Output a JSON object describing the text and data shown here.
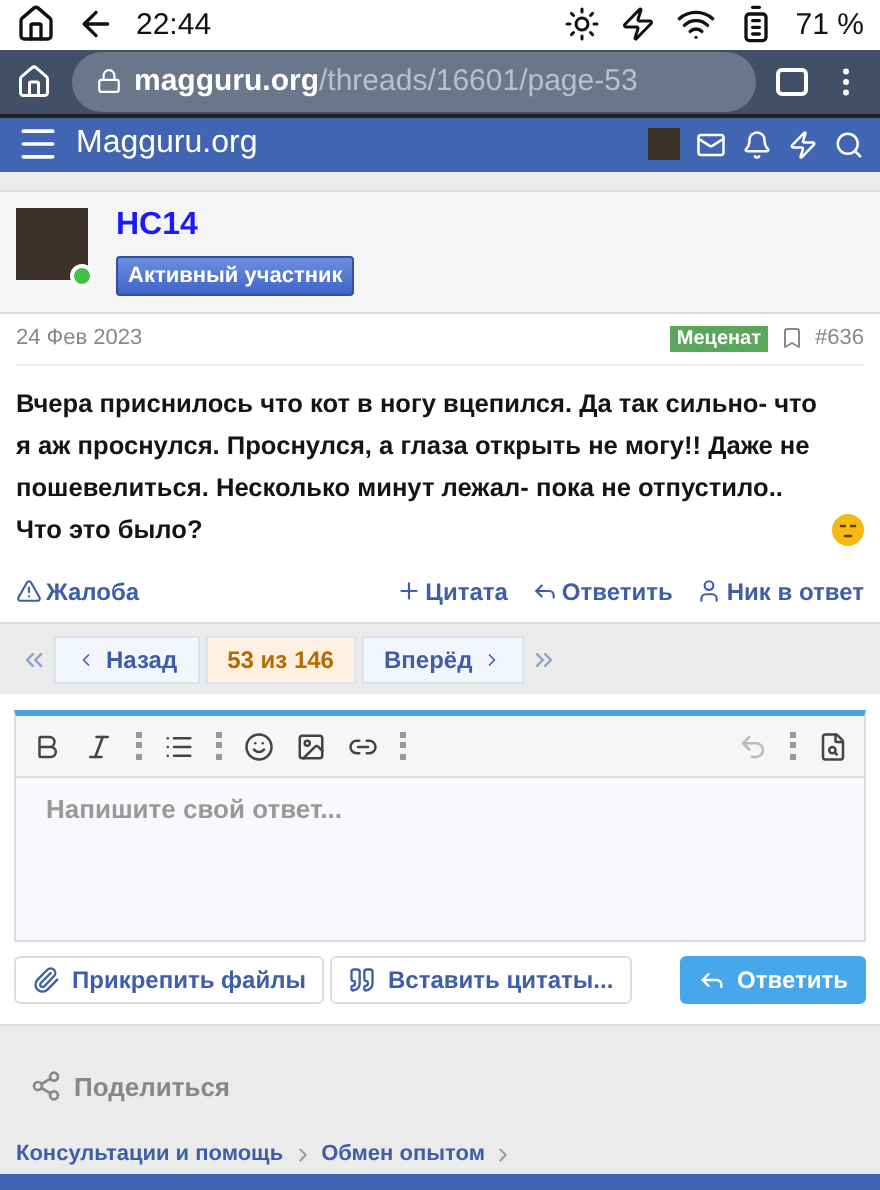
{
  "status_bar": {
    "time": "22:44",
    "battery": "71 %"
  },
  "browser": {
    "url_domain": "magguru.org",
    "url_path": "/threads/16601/page-53"
  },
  "site_nav": {
    "title": "Magguru.org"
  },
  "post": {
    "author": "HC14",
    "role": "Активный участник",
    "online": true,
    "date": "24 Фев 2023",
    "badge": "Меценат",
    "number": "#636",
    "text": "Вчера приснилось что кот в ногу вцепился. Да так сильно- что я аж проснулся. Проснулся, а глаза открыть не могу!! Даже не пошевелиться. Несколько минут лежал- пока не отпустило.. Что это было?",
    "actions": [
      {
        "kind": "report",
        "label": "Жалоба"
      },
      {
        "kind": "quote",
        "label": "Цитата"
      },
      {
        "kind": "reply",
        "label": "Ответить"
      },
      {
        "kind": "mention",
        "label": "Ник в ответ"
      }
    ]
  },
  "pagination": {
    "prev": "Назад",
    "current": "53 из 146",
    "next": "Вперёд"
  },
  "editor": {
    "placeholder": "Напишите свой ответ..."
  },
  "editor_buttons": [
    {
      "kind": "attach",
      "label": "Прикрепить файлы"
    },
    {
      "kind": "insert_quotes",
      "label": "Вставить цитаты..."
    },
    {
      "kind": "submit",
      "label": "Ответить"
    }
  ],
  "share": {
    "label": "Поделиться"
  },
  "breadcrumbs": [
    {
      "label": "Консультации и помощь"
    },
    {
      "label": "Обмен опытом"
    }
  ]
}
